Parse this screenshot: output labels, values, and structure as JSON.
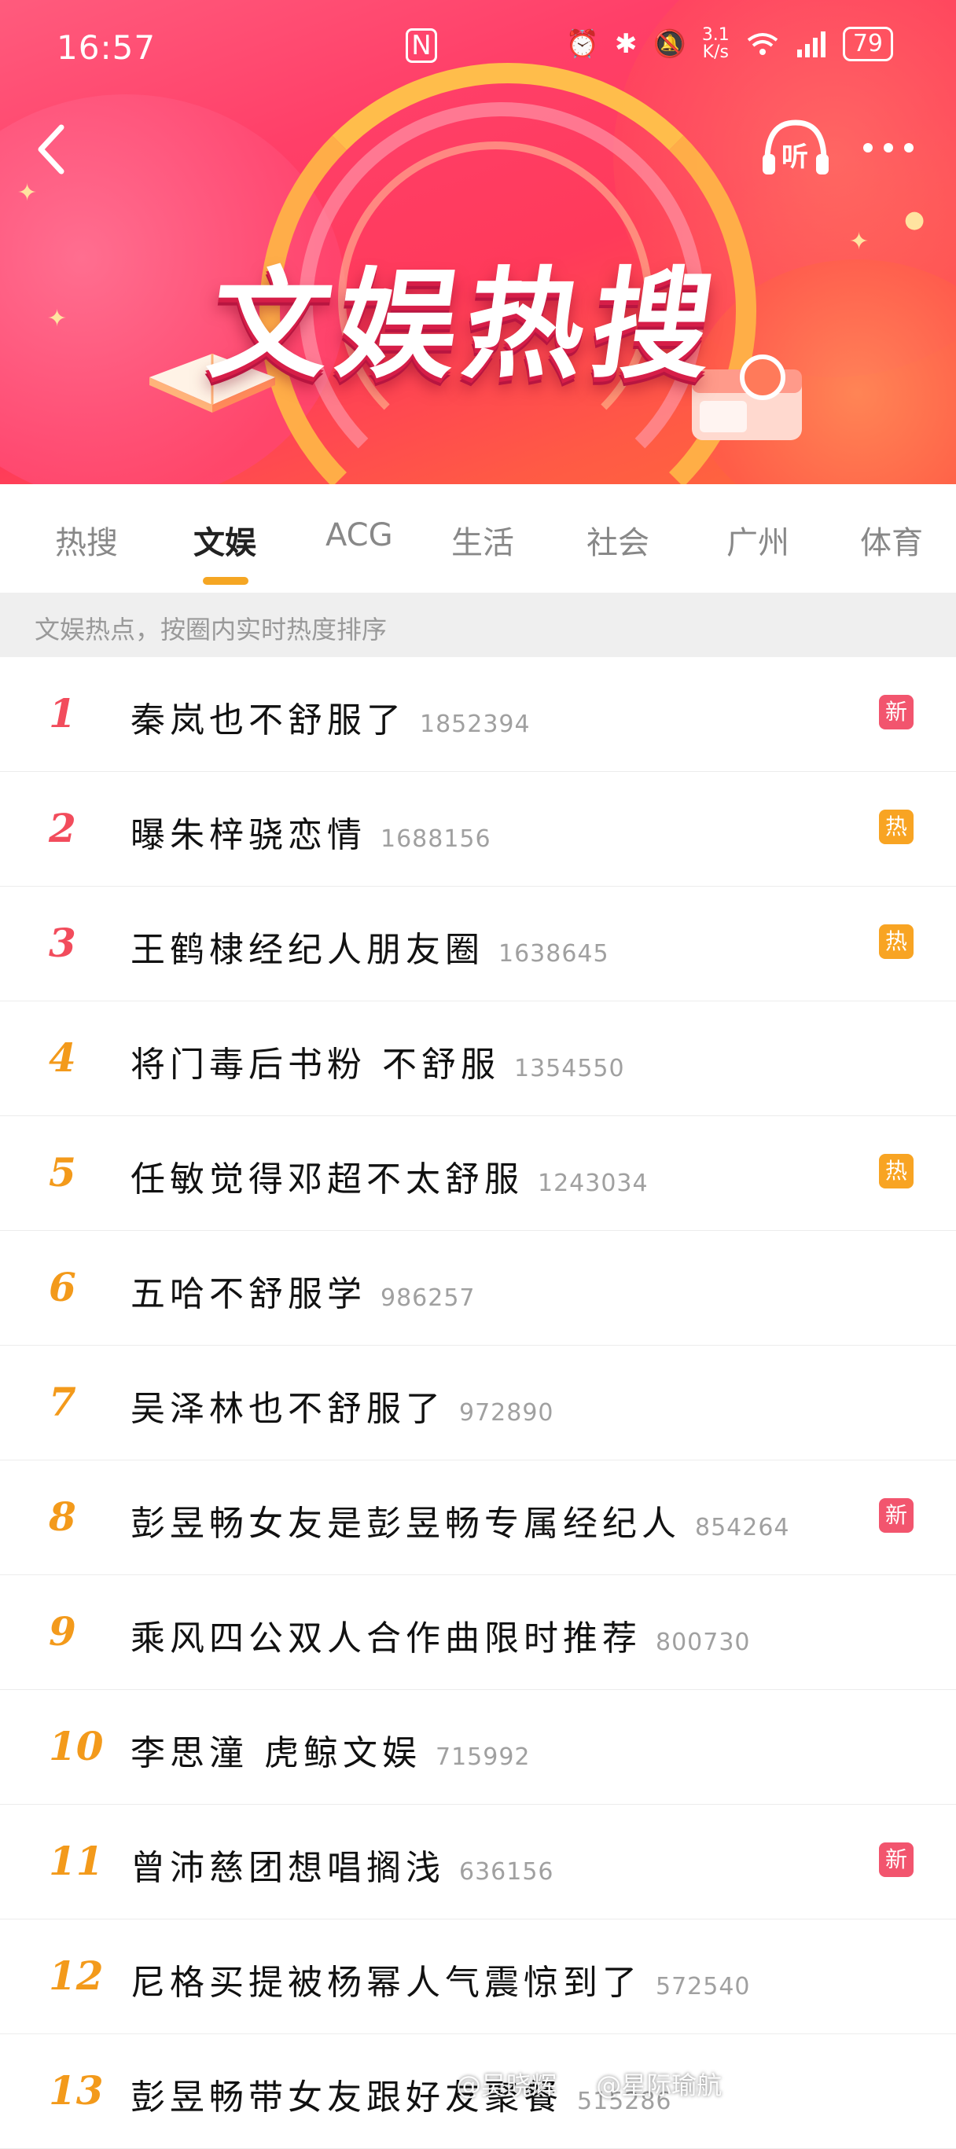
{
  "status_bar": {
    "time": "16:57",
    "net_speed_value": "3.1",
    "net_speed_unit": "K/s",
    "battery": "79"
  },
  "banner": {
    "title": "文娱热搜",
    "listen_label": "听"
  },
  "tabs": [
    {
      "label": "热搜",
      "active": false
    },
    {
      "label": "文娱",
      "active": true
    },
    {
      "label": "ACG",
      "active": false
    },
    {
      "label": "生活",
      "active": false
    },
    {
      "label": "社会",
      "active": false
    },
    {
      "label": "广州",
      "active": false
    },
    {
      "label": "体育",
      "active": false
    }
  ],
  "subheader": "文娱热点，按圈内实时热度排序",
  "colors": {
    "accent": "#f5a623",
    "rank_top": "#f24c5c",
    "rank_other": "#f39a1b",
    "badge_new": "#f2556e",
    "badge_hot": "#f8a423"
  },
  "list": [
    {
      "rank": "1",
      "title": "秦岚也不舒服了",
      "count": "1852394",
      "badge": "新",
      "badge_type": "new"
    },
    {
      "rank": "2",
      "title": "曝朱梓骁恋情",
      "count": "1688156",
      "badge": "热",
      "badge_type": "hot"
    },
    {
      "rank": "3",
      "title": "王鹤棣经纪人朋友圈",
      "count": "1638645",
      "badge": "热",
      "badge_type": "hot"
    },
    {
      "rank": "4",
      "title": "将门毒后书粉 不舒服",
      "count": "1354550",
      "badge": "",
      "badge_type": ""
    },
    {
      "rank": "5",
      "title": "任敏觉得邓超不太舒服",
      "count": "1243034",
      "badge": "热",
      "badge_type": "hot"
    },
    {
      "rank": "6",
      "title": "五哈不舒服学",
      "count": "986257",
      "badge": "",
      "badge_type": ""
    },
    {
      "rank": "7",
      "title": "吴泽林也不舒服了",
      "count": "972890",
      "badge": "",
      "badge_type": ""
    },
    {
      "rank": "8",
      "title": "彭昱畅女友是彭昱畅专属经纪人",
      "count": "854264",
      "badge": "新",
      "badge_type": "new"
    },
    {
      "rank": "9",
      "title": "乘风四公双人合作曲限时推荐",
      "count": "800730",
      "badge": "",
      "badge_type": ""
    },
    {
      "rank": "10",
      "title": "李思潼 虎鲸文娱",
      "count": "715992",
      "badge": "",
      "badge_type": ""
    },
    {
      "rank": "11",
      "title": "曾沛慈团想唱搁浅",
      "count": "636156",
      "badge": "新",
      "badge_type": "new"
    },
    {
      "rank": "12",
      "title": "尼格买提被杨幂人气震惊到了",
      "count": "572540",
      "badge": "",
      "badge_type": ""
    },
    {
      "rank": "13",
      "title": "彭昱畅带女友跟好友聚餐",
      "count": "515286",
      "badge": "",
      "badge_type": ""
    }
  ],
  "watermarks": [
    "@吴晓辉",
    "@星际瑜航"
  ]
}
